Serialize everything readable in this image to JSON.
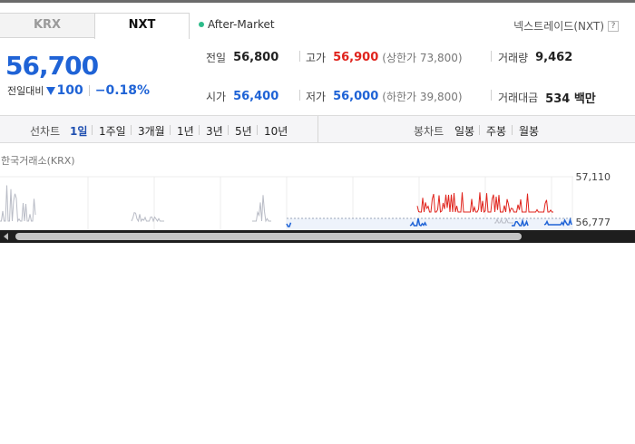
{
  "tabs": [
    {
      "label": "KRX",
      "active": false
    },
    {
      "label": "NXT",
      "active": true
    }
  ],
  "market_status": "After-Market",
  "exchange_link": "넥스트레이드(NXT)",
  "help_label": "?",
  "price": {
    "current": "56,700",
    "change_label": "전일대비",
    "change": "100",
    "change_pct": "−0.18%",
    "direction": "down"
  },
  "stats": {
    "prev_close": {
      "label": "전일",
      "value": "56,800"
    },
    "high": {
      "label": "고가",
      "value": "56,900",
      "sub": "(상한가 73,800)"
    },
    "volume": {
      "label": "거래량",
      "value": "9,462"
    },
    "open": {
      "label": "시가",
      "value": "56,400"
    },
    "low": {
      "label": "저가",
      "value": "56,000",
      "sub": "(하한가 39,800)"
    },
    "amount": {
      "label": "거래대금",
      "value": "534 백만"
    }
  },
  "period_bar": {
    "line_label": "선차트",
    "line_periods": [
      "1일",
      "1주일",
      "3개월",
      "1년",
      "3년",
      "5년",
      "10년"
    ],
    "active_period": "1일",
    "candle_label": "봉차트",
    "candle_periods": [
      "일봉",
      "주봉",
      "월봉"
    ]
  },
  "chart": {
    "title": "한국거래소(KRX)",
    "y_top": "57,110",
    "y_mid": "56,777"
  },
  "colors": {
    "up": "#e0241d",
    "down": "#1f63d6",
    "neutral": "#b9bcc6",
    "accent": "#2dbb8a"
  }
}
